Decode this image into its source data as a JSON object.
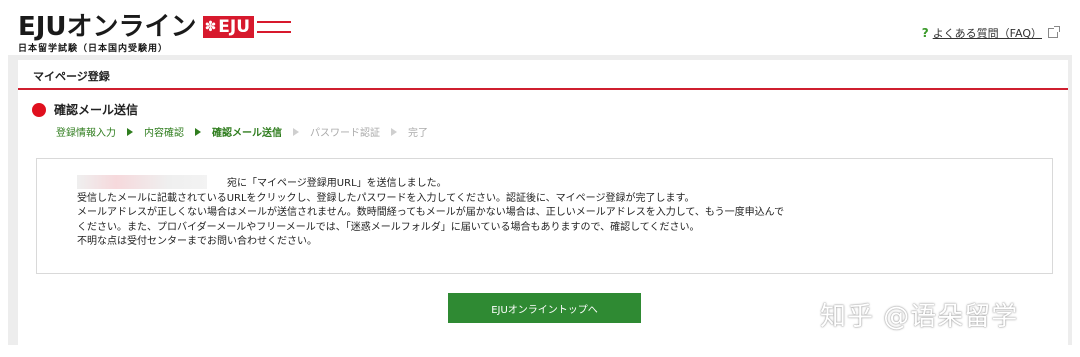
{
  "header": {
    "logo_text": "EJUオンライン",
    "logo_badge": "EJU",
    "logo_flower": "✽",
    "logo_sub": "日本留学試験（日本国内受験用）",
    "faq_icon": "?",
    "faq_label": "よくある質問（FAQ）",
    "faq_ext_icon": "external-link-icon"
  },
  "panel": {
    "title": "マイページ登録"
  },
  "step": {
    "title": "確認メール送信",
    "items": [
      {
        "label": "登録情報入力",
        "state": "done"
      },
      {
        "label": "内容確認",
        "state": "done"
      },
      {
        "label": "確認メール送信",
        "state": "current"
      },
      {
        "label": "パスワード認証",
        "state": "future"
      },
      {
        "label": "完了",
        "state": "future"
      }
    ]
  },
  "message": {
    "line1": "宛に「マイページ登録用URL」を送信しました。",
    "line2": "受信したメールに記載されているURLをクリックし、登録したパスワードを入力してください。認証後に、マイページ登録が完了します。",
    "line3": "メールアドレスが正しくない場合はメールが送信されません。数時間経ってもメールが届かない場合は、正しいメールアドレスを入力して、もう一度申込んで",
    "line4": "ください。また、プロバイダーメールやフリーメールでは、「迷惑メールフォルダ」に届いている場合もありますので、確認してください。",
    "line5": "不明な点は受付センターまでお問い合わせください。"
  },
  "button": {
    "top_label": "EJUオンライントップへ"
  },
  "watermark": "知乎 @语朵留学",
  "colors": {
    "accent_red": "#cf1f2f",
    "step_green": "#2f7d1e",
    "button_green": "#2f8a33"
  }
}
